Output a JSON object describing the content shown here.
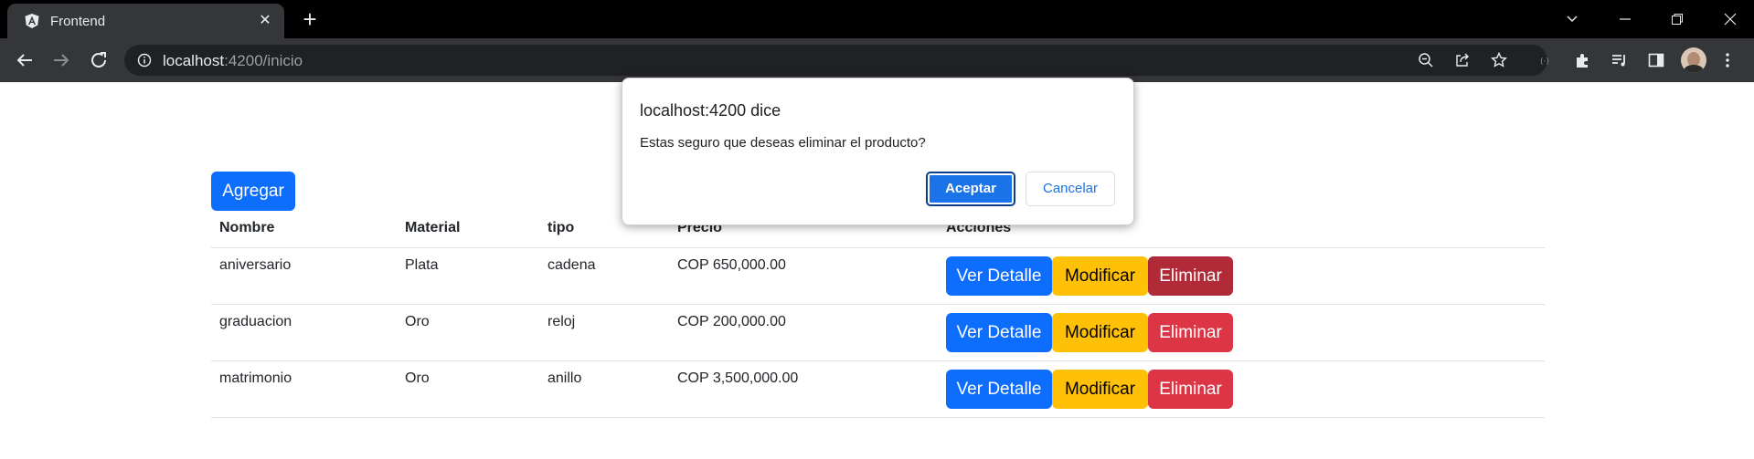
{
  "browser": {
    "tab_title": "Frontend",
    "url_host": "localhost",
    "url_path": ":4200/inicio"
  },
  "page": {
    "add_button": "Agregar",
    "columns": [
      "Nombre",
      "Material",
      "tipo",
      "Precio",
      "Acciones"
    ],
    "rows": [
      {
        "nombre": "aniversario",
        "material": "Plata",
        "tipo": "cadena",
        "precio": "COP 650,000.00"
      },
      {
        "nombre": "graduacion",
        "material": "Oro",
        "tipo": "reloj",
        "precio": "COP 200,000.00"
      },
      {
        "nombre": "matrimonio",
        "material": "Oro",
        "tipo": "anillo",
        "precio": "COP 3,500,000.00"
      }
    ],
    "actions": {
      "view": "Ver Detalle",
      "edit": "Modificar",
      "delete": "Eliminar"
    }
  },
  "dialog": {
    "title": "localhost:4200 dice",
    "message": "Estas seguro que deseas eliminar el producto?",
    "ok": "Aceptar",
    "cancel": "Cancelar"
  },
  "colors": {
    "primary": "#0d6efd",
    "warning": "#ffc107",
    "danger": "#dc3545",
    "dialog_accent": "#1a73e8"
  }
}
